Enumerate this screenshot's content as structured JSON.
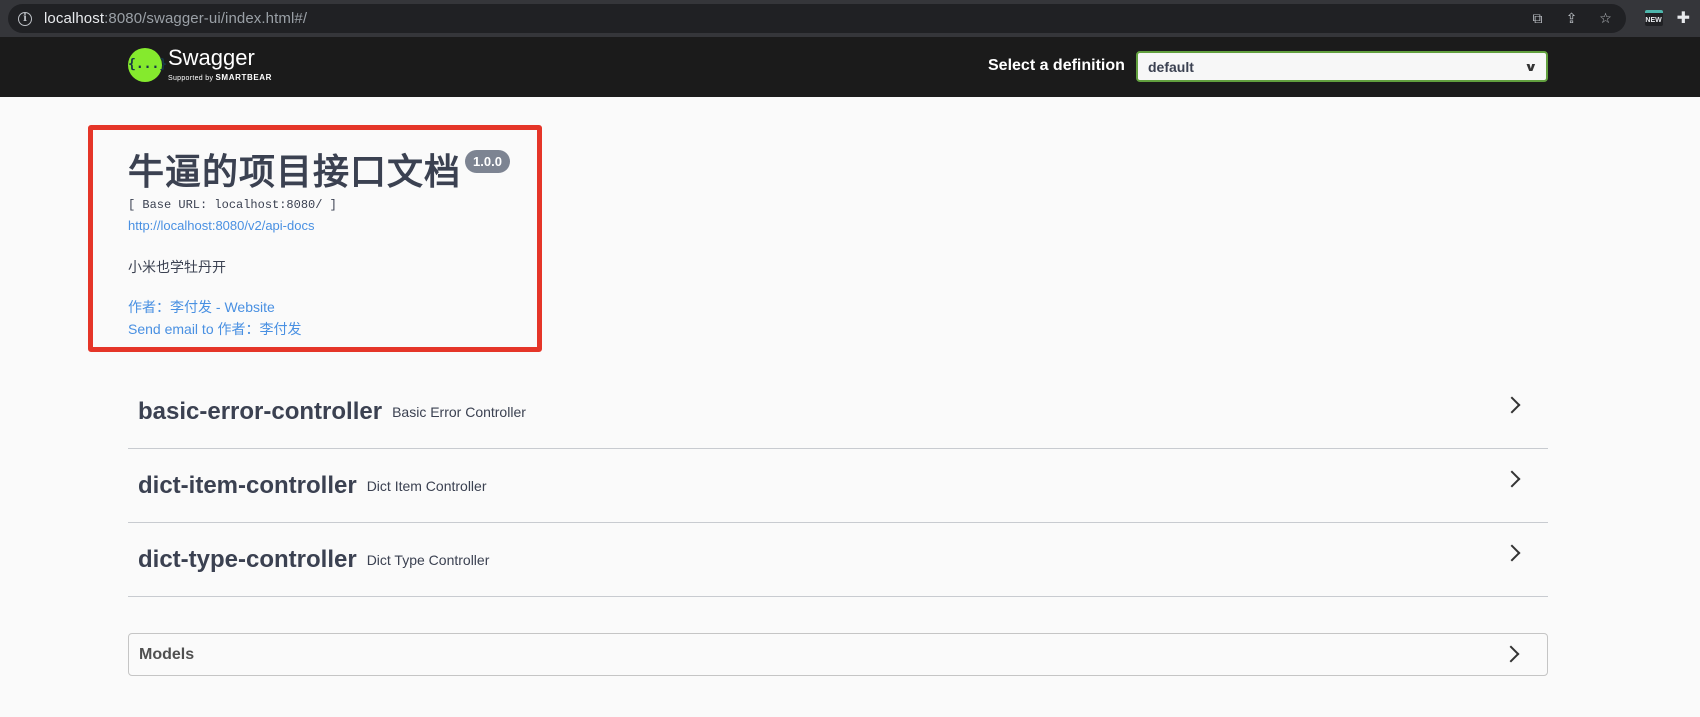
{
  "browser": {
    "url_host": "localhost",
    "url_rest": ":8080/swagger-ui/index.html#/"
  },
  "topbar": {
    "logo_title": "Swagger",
    "logo_symbol": "{...}",
    "logo_sub_prefix": "Supported by ",
    "logo_sub_brand": "SMARTBEAR",
    "definition_label": "Select a definition",
    "definition_value": "default"
  },
  "info": {
    "title": "牛逼的项目接口文档",
    "version": "1.0.0",
    "base_url": "[ Base URL: localhost:8080/ ]",
    "api_docs_link": "http://localhost:8080/v2/api-docs",
    "description": "小米也学牡丹开",
    "contact_website": "作者：李付发 - Website",
    "contact_email": "Send email to 作者：李付发"
  },
  "tags": [
    {
      "name": "basic-error-controller",
      "description": "Basic Error Controller"
    },
    {
      "name": "dict-item-controller",
      "description": "Dict Item Controller"
    },
    {
      "name": "dict-type-controller",
      "description": "Dict Type Controller"
    }
  ],
  "models": {
    "title": "Models"
  },
  "colors": {
    "highlight": "#e53528",
    "link": "#4990e2",
    "swagger_green": "#85ea2d"
  }
}
